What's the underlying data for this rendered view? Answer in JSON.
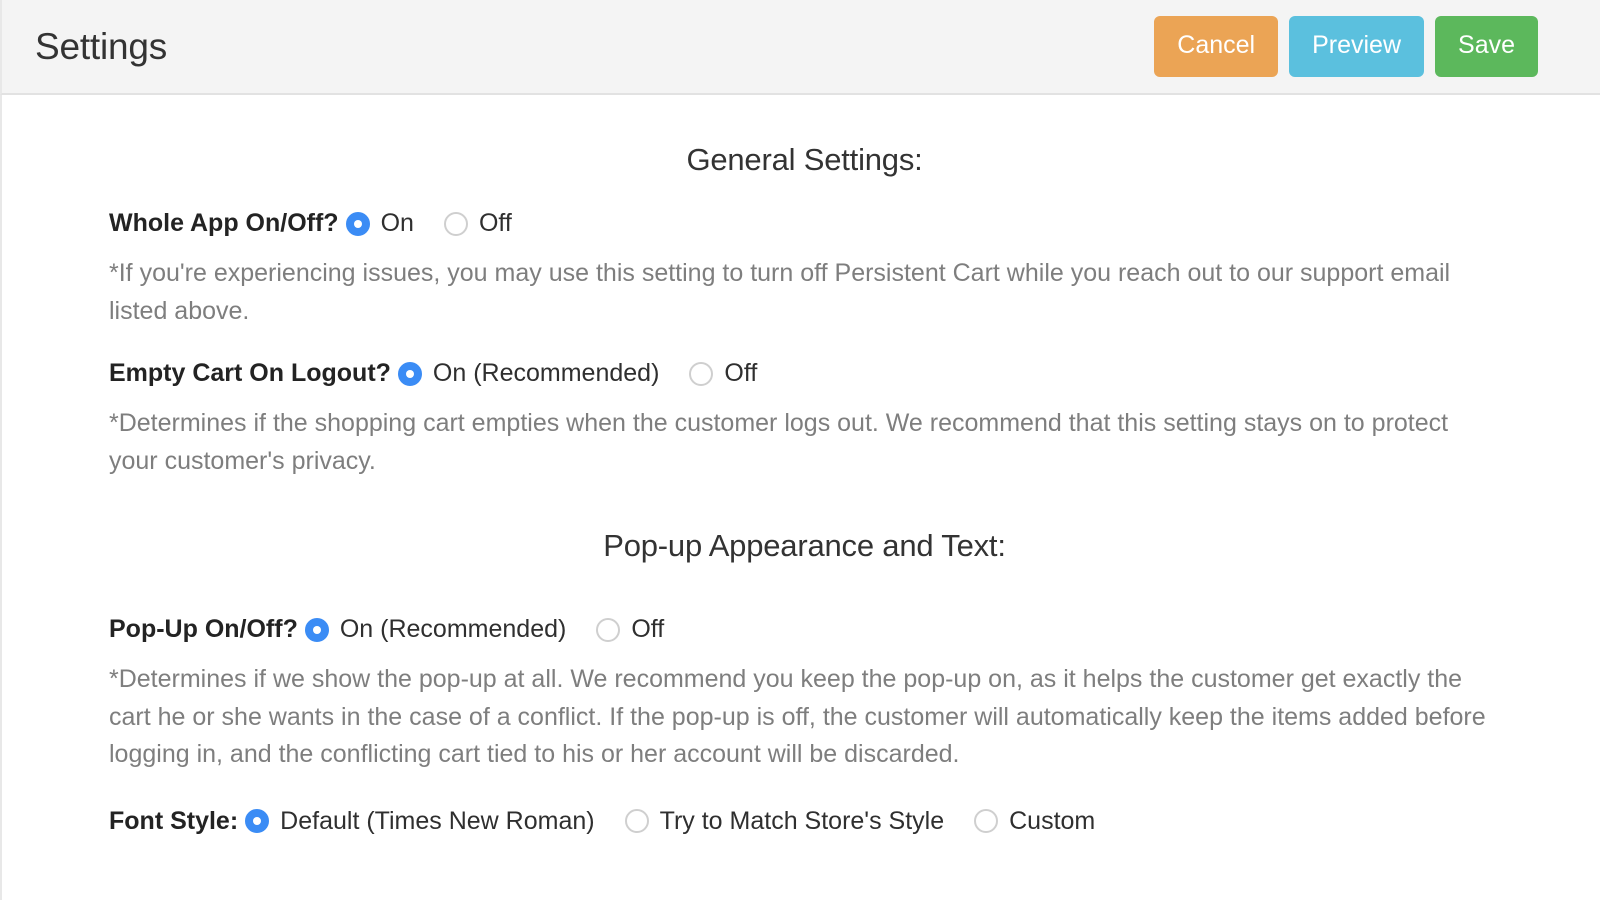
{
  "header": {
    "title": "Settings",
    "buttons": [
      {
        "label": "Cancel",
        "color": "#eba455"
      },
      {
        "label": "Preview",
        "color": "#5bc0de"
      },
      {
        "label": "Save",
        "color": "#5cb85c"
      }
    ]
  },
  "colors": {
    "radio_selected": "#3b8cf5",
    "radio_unselected_border": "#cfcfcf",
    "topbar_background": "#f4f4f4",
    "helper_text": "#7e7e7e",
    "heading_text": "#333333"
  },
  "sections": [
    {
      "heading": "General Settings:",
      "settings": [
        {
          "label": "Whole App On/Off?",
          "options": [
            {
              "text": "On",
              "selected": true
            },
            {
              "text": "Off",
              "selected": false
            }
          ],
          "helper": "*If you're experiencing issues, you may use this setting to turn off Persistent Cart while you reach out to our support email listed above."
        },
        {
          "label": "Empty Cart On Logout?",
          "options": [
            {
              "text": "On (Recommended)",
              "selected": true
            },
            {
              "text": "Off",
              "selected": false
            }
          ],
          "helper": "*Determines if the shopping cart empties when the customer logs out. We recommend that this setting stays on to protect your customer's privacy."
        }
      ]
    },
    {
      "heading": "Pop-up Appearance and Text:",
      "settings": [
        {
          "label": "Pop-Up On/Off?",
          "options": [
            {
              "text": "On (Recommended)",
              "selected": true
            },
            {
              "text": "Off",
              "selected": false
            }
          ],
          "helper": "*Determines if we show the pop-up at all. We recommend you keep the pop-up on, as it helps the customer get exactly the cart he or she wants in the case of a conflict. If the pop-up is off, the customer will automatically keep the items added before logging in, and the conflicting cart tied to his or her account will be discarded."
        },
        {
          "label": "Font Style:",
          "options": [
            {
              "text": "Default (Times New Roman)",
              "selected": true
            },
            {
              "text": "Try to Match Store's Style",
              "selected": false
            },
            {
              "text": "Custom",
              "selected": false
            }
          ],
          "helper": null
        }
      ]
    }
  ]
}
